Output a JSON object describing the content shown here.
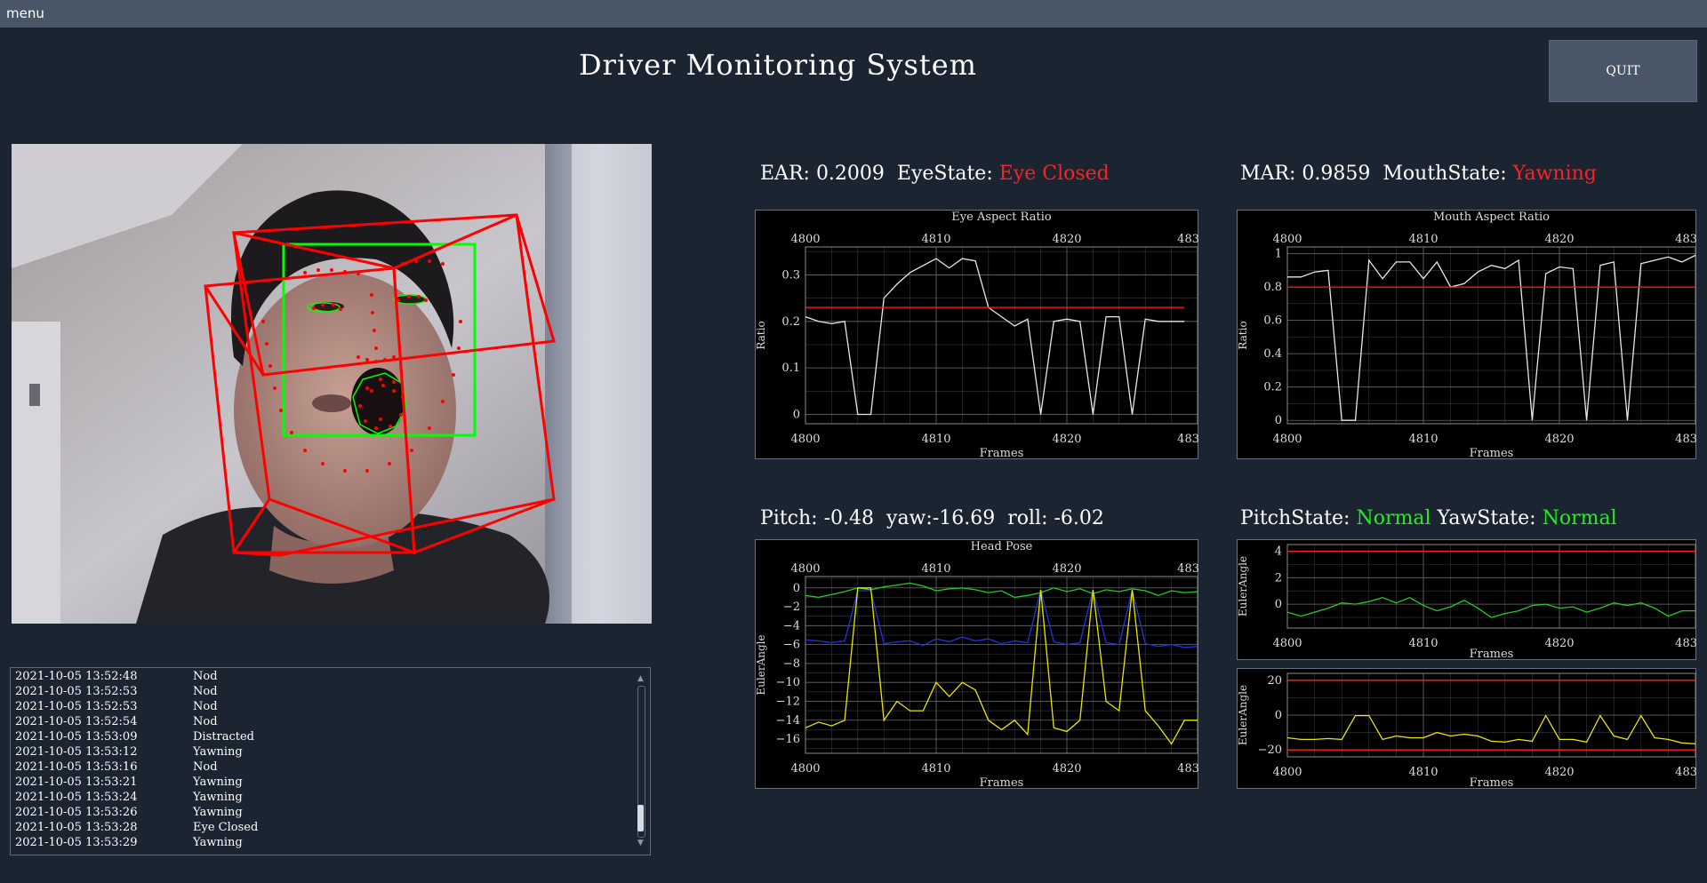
{
  "menubar": {
    "menu_label": "menu"
  },
  "header": {
    "title": "Driver Monitoring System",
    "quit_label": "QUIT"
  },
  "eye_readout": {
    "ear_label": "EAR:",
    "ear_value": "0.2009",
    "state_label": "EyeState:",
    "state_value": "Eye Closed"
  },
  "mouth_readout": {
    "mar_label": "MAR:",
    "mar_value": "0.9859",
    "state_label": "MouthState:",
    "state_value": "Yawning"
  },
  "pose_readout": {
    "pitch_label": "Pitch:",
    "pitch_value": "-0.48",
    "yaw_label": "yaw:",
    "yaw_value": "-16.69",
    "roll_label": "roll:",
    "roll_value": "-6.02"
  },
  "pose_state_readout": {
    "pitch_state_label": "PitchState:",
    "pitch_state_value": "Normal",
    "yaw_state_label": "YawState:",
    "yaw_state_value": "Normal"
  },
  "log": {
    "entries": [
      {
        "time": "2021-10-05 13:52:48",
        "event": "Nod"
      },
      {
        "time": "2021-10-05 13:52:53",
        "event": "Nod"
      },
      {
        "time": "2021-10-05 13:52:53",
        "event": "Nod"
      },
      {
        "time": "2021-10-05 13:52:54",
        "event": "Nod"
      },
      {
        "time": "2021-10-05 13:53:09",
        "event": "Distracted"
      },
      {
        "time": "2021-10-05 13:53:12",
        "event": "Yawning"
      },
      {
        "time": "2021-10-05 13:53:16",
        "event": "Nod"
      },
      {
        "time": "2021-10-05 13:53:21",
        "event": "Yawning"
      },
      {
        "time": "2021-10-05 13:53:24",
        "event": "Yawning"
      },
      {
        "time": "2021-10-05 13:53:26",
        "event": "Yawning"
      },
      {
        "time": "2021-10-05 13:53:28",
        "event": "Eye Closed"
      },
      {
        "time": "2021-10-05 13:53:29",
        "event": "Yawning"
      }
    ]
  },
  "colors": {
    "alert": "#ff2020",
    "normal": "#22ee22",
    "background": "#1b2532",
    "bar": "#485668"
  },
  "chart_data": [
    {
      "type": "line",
      "title": "Eye Aspect Ratio",
      "xlabel": "Frames",
      "ylabel": "Ratio",
      "xlim": [
        4800,
        4830
      ],
      "ylim": [
        -0.02,
        0.36
      ],
      "x_ticks": [
        4800,
        4810,
        4820,
        4830
      ],
      "x_tick_labels": [
        "4800",
        "4810",
        "4820",
        "483"
      ],
      "y_ticks": [
        0,
        0.1,
        0.2,
        0.3
      ],
      "y_tick_labels": [
        "0",
        "0.1",
        "0.2",
        "0.3"
      ],
      "grid": true,
      "series": [
        {
          "color": "#e8e8e8",
          "x": [
            4800,
            4801,
            4802,
            4803,
            4804,
            4805,
            4806,
            4807,
            4808,
            4809,
            4810,
            4811,
            4812,
            4813,
            4814,
            4815,
            4816,
            4817,
            4818,
            4819,
            4820,
            4821,
            4822,
            4823,
            4824,
            4825,
            4826,
            4827,
            4828,
            4829
          ],
          "y": [
            0.21,
            0.2,
            0.195,
            0.2,
            0.0,
            0.0,
            0.25,
            0.28,
            0.305,
            0.32,
            0.335,
            0.315,
            0.335,
            0.33,
            0.23,
            0.21,
            0.19,
            0.205,
            0.0,
            0.2,
            0.205,
            0.2,
            0.0,
            0.21,
            0.21,
            0.0,
            0.205,
            0.2,
            0.2,
            0.2
          ]
        },
        {
          "color": "#ff2020",
          "x": [
            4800,
            4829
          ],
          "y": [
            0.23,
            0.23
          ]
        }
      ]
    },
    {
      "type": "line",
      "title": "Mouth Aspect Ratio",
      "xlabel": "Frames",
      "ylabel": "Ratio",
      "xlim": [
        4800,
        4830
      ],
      "ylim": [
        -0.02,
        1.04
      ],
      "x_ticks": [
        4800,
        4810,
        4820,
        4830
      ],
      "x_tick_labels": [
        "4800",
        "4810",
        "4820",
        "483"
      ],
      "y_ticks": [
        0,
        0.2,
        0.4,
        0.6,
        0.8,
        1
      ],
      "y_tick_labels": [
        "0",
        "0.2",
        "0.4",
        "0.6",
        "0.8",
        "1"
      ],
      "grid": true,
      "series": [
        {
          "color": "#e8e8e8",
          "x": [
            4800,
            4801,
            4802,
            4803,
            4804,
            4805,
            4806,
            4807,
            4808,
            4809,
            4810,
            4811,
            4812,
            4813,
            4814,
            4815,
            4816,
            4817,
            4818,
            4819,
            4820,
            4821,
            4822,
            4823,
            4824,
            4825,
            4826,
            4827,
            4828,
            4829,
            4830
          ],
          "y": [
            0.86,
            0.86,
            0.89,
            0.9,
            0.0,
            0.0,
            0.96,
            0.85,
            0.95,
            0.95,
            0.85,
            0.95,
            0.8,
            0.82,
            0.89,
            0.93,
            0.91,
            0.96,
            0.0,
            0.88,
            0.92,
            0.91,
            0.0,
            0.93,
            0.95,
            0.0,
            0.94,
            0.96,
            0.98,
            0.95,
            0.99
          ]
        },
        {
          "color": "#ff2020",
          "x": [
            4800,
            4830
          ],
          "y": [
            0.8,
            0.8
          ]
        }
      ]
    },
    {
      "type": "line",
      "title": "Head Pose",
      "xlabel": "Frames",
      "ylabel": "EulerAngle",
      "xlim": [
        4800,
        4830
      ],
      "ylim": [
        -17.5,
        1.2
      ],
      "x_ticks": [
        4800,
        4810,
        4820,
        4830
      ],
      "x_tick_labels": [
        "4800",
        "4810",
        "4820",
        "483"
      ],
      "y_ticks": [
        0,
        -2,
        -4,
        -6,
        -8,
        -10,
        -12,
        -14,
        -16
      ],
      "y_tick_labels": [
        "0",
        "−2",
        "−4",
        "−6",
        "−8",
        "−10",
        "−12",
        "−14",
        "−16"
      ],
      "grid": true,
      "series": [
        {
          "color": "#22cc22",
          "x": [
            4800,
            4801,
            4802,
            4803,
            4804,
            4805,
            4806,
            4807,
            4808,
            4809,
            4810,
            4811,
            4812,
            4813,
            4814,
            4815,
            4816,
            4817,
            4818,
            4819,
            4820,
            4821,
            4822,
            4823,
            4824,
            4825,
            4826,
            4827,
            4828,
            4829,
            4830
          ],
          "y": [
            -0.8,
            -1.0,
            -0.7,
            -0.4,
            0.0,
            -0.2,
            0.1,
            0.3,
            0.5,
            0.2,
            -0.3,
            -0.1,
            0.0,
            -0.2,
            -0.5,
            -0.3,
            -1.0,
            -0.8,
            -0.5,
            0.0,
            -0.4,
            -0.1,
            -0.6,
            -0.2,
            -0.4,
            -0.1,
            -0.3,
            -0.8,
            -0.3,
            -0.5,
            -0.4
          ]
        },
        {
          "color": "#2233dd",
          "x": [
            4800,
            4801,
            4802,
            4803,
            4804,
            4805,
            4806,
            4807,
            4808,
            4809,
            4810,
            4811,
            4812,
            4813,
            4814,
            4815,
            4816,
            4817,
            4818,
            4819,
            4820,
            4821,
            4822,
            4823,
            4824,
            4825,
            4826,
            4827,
            4828,
            4829,
            4830
          ],
          "y": [
            -5.5,
            -5.6,
            -5.8,
            -5.6,
            -0.3,
            -0.3,
            -5.9,
            -5.7,
            -5.6,
            -6.1,
            -5.4,
            -5.7,
            -5.2,
            -5.6,
            -5.4,
            -5.9,
            -5.6,
            -5.8,
            -0.2,
            -5.7,
            -6.0,
            -5.8,
            -0.2,
            -5.8,
            -6.0,
            -0.2,
            -5.9,
            -6.2,
            -6.0,
            -6.3,
            -6.2
          ]
        },
        {
          "color": "#e8e800",
          "x": [
            4800,
            4801,
            4802,
            4803,
            4804,
            4805,
            4806,
            4807,
            4808,
            4809,
            4810,
            4811,
            4812,
            4813,
            4814,
            4815,
            4816,
            4817,
            4818,
            4819,
            4820,
            4821,
            4822,
            4823,
            4824,
            4825,
            4826,
            4827,
            4828,
            4829,
            4830
          ],
          "y": [
            -14.8,
            -14.2,
            -14.6,
            -14.0,
            0.0,
            0.0,
            -14.0,
            -12.0,
            -13.0,
            -13.0,
            -10.0,
            -11.5,
            -10.0,
            -10.8,
            -14.0,
            -15.0,
            -14.0,
            -15.5,
            -0.2,
            -14.8,
            -15.2,
            -14.0,
            -0.2,
            -12.0,
            -13.0,
            -0.2,
            -13.0,
            -14.6,
            -16.5,
            -14.0,
            -14.0
          ]
        }
      ]
    },
    {
      "type": "line",
      "title": "",
      "xlabel": "Frames",
      "ylabel": "EulerAngle",
      "xlim": [
        4800,
        4830
      ],
      "ylim": [
        -1.8,
        4.5
      ],
      "x_ticks": [
        4800,
        4810,
        4820,
        4830
      ],
      "x_tick_labels": [
        "4800",
        "4810",
        "4820",
        "483"
      ],
      "y_ticks": [
        4,
        2,
        0
      ],
      "y_tick_labels": [
        "4",
        "2",
        "0"
      ],
      "grid": true,
      "series": [
        {
          "color": "#ff2020",
          "x": [
            4800,
            4830
          ],
          "y": [
            4,
            4
          ]
        },
        {
          "color": "#22cc22",
          "x": [
            4800,
            4801,
            4802,
            4803,
            4804,
            4805,
            4806,
            4807,
            4808,
            4809,
            4810,
            4811,
            4812,
            4813,
            4814,
            4815,
            4816,
            4817,
            4818,
            4819,
            4820,
            4821,
            4822,
            4823,
            4824,
            4825,
            4826,
            4827,
            4828,
            4829,
            4830
          ],
          "y": [
            -0.6,
            -0.9,
            -0.6,
            -0.3,
            0.1,
            0.0,
            0.2,
            0.5,
            0.1,
            0.5,
            -0.1,
            -0.5,
            -0.2,
            0.3,
            -0.3,
            -1.0,
            -0.7,
            -0.5,
            -0.1,
            0.0,
            -0.3,
            -0.2,
            -0.6,
            -0.3,
            0.1,
            -0.1,
            0.1,
            -0.3,
            -0.9,
            -0.5,
            -0.5
          ]
        }
      ]
    },
    {
      "type": "line",
      "title": "",
      "xlabel": "Frames",
      "ylabel": "EulerAngle",
      "xlim": [
        4800,
        4830
      ],
      "ylim": [
        -24,
        24
      ],
      "x_ticks": [
        4800,
        4810,
        4820,
        4830
      ],
      "x_tick_labels": [
        "4800",
        "4810",
        "4820",
        "483"
      ],
      "y_ticks": [
        20,
        0,
        -20
      ],
      "y_tick_labels": [
        "20",
        "0",
        "−20"
      ],
      "grid": true,
      "series": [
        {
          "color": "#ff2020",
          "x": [
            4800,
            4830
          ],
          "y": [
            20,
            20
          ]
        },
        {
          "color": "#ff2020",
          "x": [
            4800,
            4830
          ],
          "y": [
            -20,
            -20
          ]
        },
        {
          "color": "#e8e800",
          "x": [
            4800,
            4801,
            4802,
            4803,
            4804,
            4805,
            4806,
            4807,
            4808,
            4809,
            4810,
            4811,
            4812,
            4813,
            4814,
            4815,
            4816,
            4817,
            4818,
            4819,
            4820,
            4821,
            4822,
            4823,
            4824,
            4825,
            4826,
            4827,
            4828,
            4829,
            4830
          ],
          "y": [
            -13,
            -14,
            -14,
            -13.5,
            -14,
            -0.3,
            -0.3,
            -14,
            -12,
            -13,
            -13,
            -10,
            -12,
            -11,
            -12,
            -15,
            -15.5,
            -14,
            -15,
            -0.3,
            -14,
            -14,
            -15.5,
            -0.3,
            -12,
            -14,
            -0.3,
            -13,
            -14,
            -16,
            -16.5
          ]
        }
      ]
    }
  ]
}
